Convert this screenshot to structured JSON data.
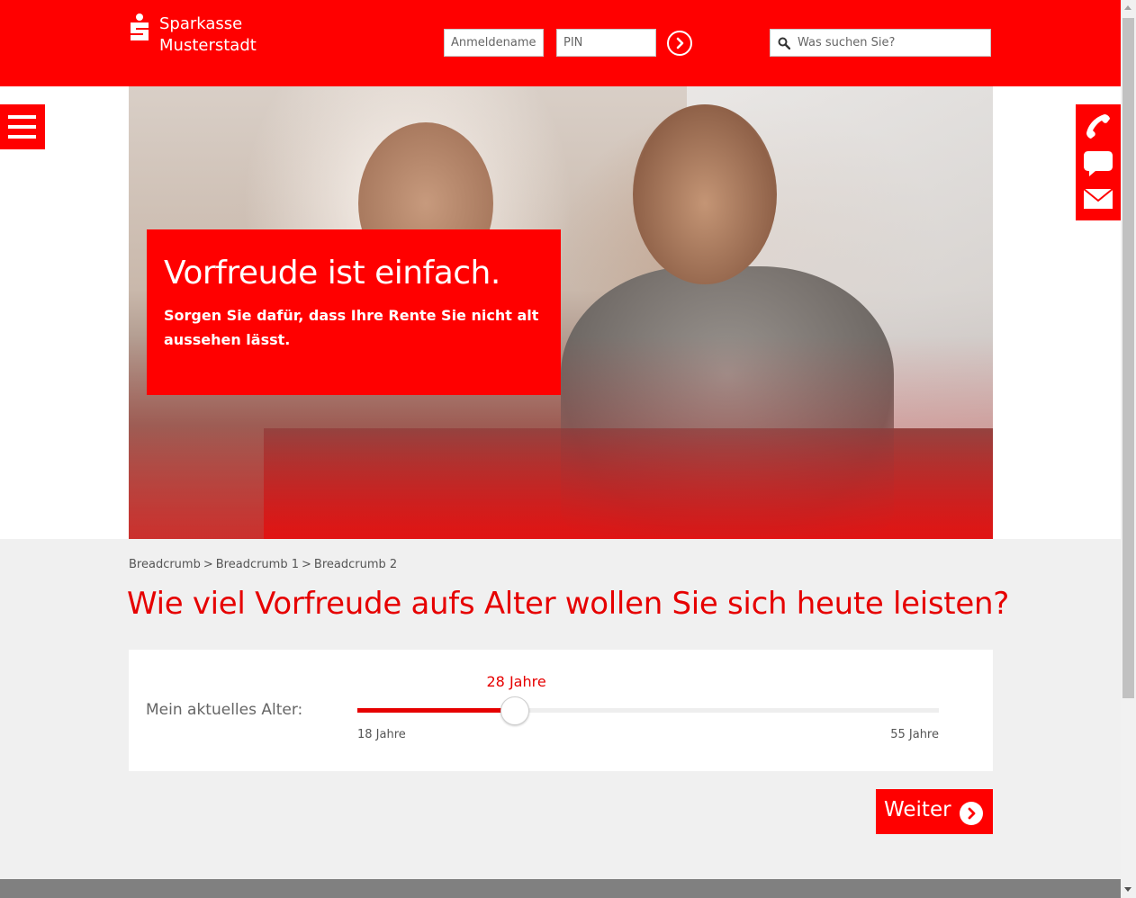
{
  "header": {
    "bank_name_line1": "Sparkasse",
    "bank_name_line2": "Musterstadt",
    "username_placeholder": "Anmeldename",
    "pin_placeholder": "PIN",
    "search_placeholder": "Was suchen Sie?",
    "brand_color": "#ff0000"
  },
  "icons": {
    "menu": "hamburger-icon",
    "login_go": "arrow-right-circle-icon",
    "search": "search-icon",
    "phone": "phone-icon",
    "chat": "chat-icon",
    "mail": "mail-icon",
    "next": "arrow-right-circle-icon"
  },
  "hero": {
    "headline": "Vorfreude ist einfach.",
    "subline": "Sorgen Sie dafür, dass Ihre Rente Sie nicht alt aussehen lässt."
  },
  "breadcrumb": [
    "Breadcrumb",
    "Breadcrumb 1",
    "Breadcrumb 2"
  ],
  "breadcrumb_separator": ">",
  "page_title": "Wie viel Vorfreude aufs Alter wollen Sie sich heute leisten?",
  "age_slider": {
    "label": "Mein aktuelles Alter:",
    "value": 28,
    "value_text": "28 Jahre",
    "min": 18,
    "max": 55,
    "min_text": "18 Jahre",
    "max_text": "55 Jahre",
    "accent_color": "#e60000"
  },
  "next_button": {
    "label": "Weiter"
  }
}
